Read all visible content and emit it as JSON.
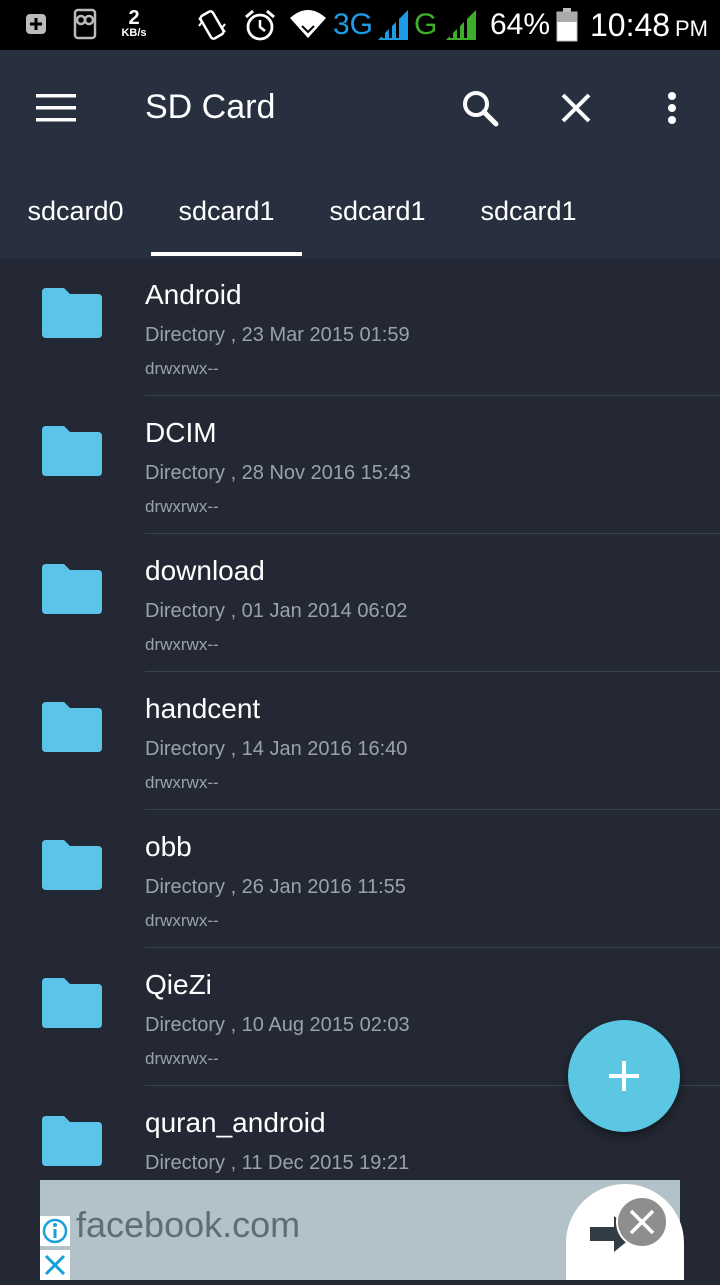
{
  "status_bar": {
    "speed_value": "2",
    "speed_unit": "KB/s",
    "network_3g": "3G",
    "network_g": "G",
    "battery": "64%",
    "time": "10:48",
    "ampm": "PM"
  },
  "toolbar": {
    "title": "SD Card",
    "tabs": [
      "sdcard0",
      "sdcard1",
      "sdcard1",
      "sdcard1"
    ],
    "selected_tab_index": 1
  },
  "files": [
    {
      "name": "Android",
      "meta": "Directory , 23 Mar 2015 01:59",
      "perm": "drwxrwx--"
    },
    {
      "name": "DCIM",
      "meta": "Directory , 28 Nov 2016 15:43",
      "perm": "drwxrwx--"
    },
    {
      "name": "download",
      "meta": "Directory , 01 Jan 2014 06:02",
      "perm": "drwxrwx--"
    },
    {
      "name": "handcent",
      "meta": "Directory , 14 Jan 2016 16:40",
      "perm": "drwxrwx--"
    },
    {
      "name": "obb",
      "meta": "Directory , 26 Jan 2016 11:55",
      "perm": "drwxrwx--"
    },
    {
      "name": "QieZi",
      "meta": "Directory , 10 Aug 2015 02:03",
      "perm": "drwxrwx--"
    },
    {
      "name": "quran_android",
      "meta": "Directory , 11 Dec 2015 19:21",
      "perm": ""
    }
  ],
  "ad": {
    "domain": "facebook.com"
  },
  "colors": {
    "background": "#232834",
    "toolbar": "#283040",
    "folder": "#5bc4e8",
    "fab": "#5cc7e3",
    "secondary_text": "#9aa1ad"
  },
  "icons": {
    "menu": "hamburger-menu-icon",
    "search": "search-icon",
    "close": "close-icon",
    "more": "more-vertical-icon",
    "folder": "folder-icon",
    "fab": "plus-icon"
  }
}
